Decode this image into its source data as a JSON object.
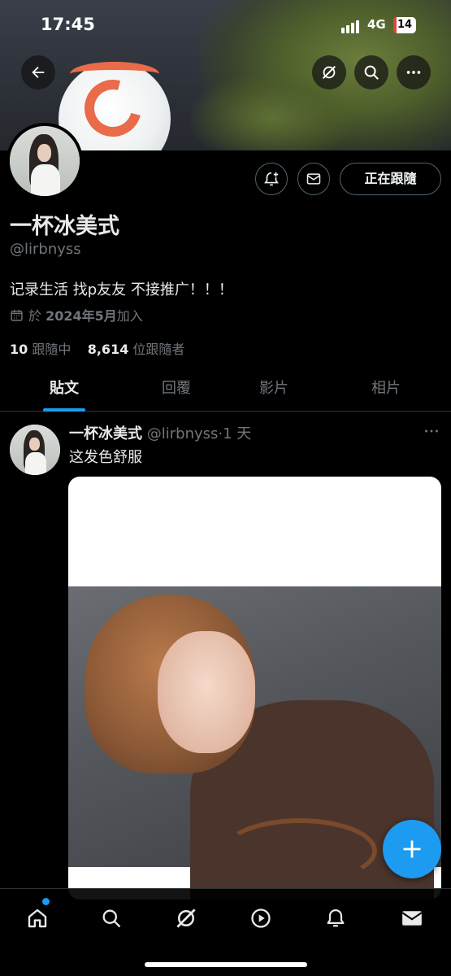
{
  "status_bar": {
    "time": "17:45",
    "network": "4G",
    "battery": "14"
  },
  "profile": {
    "display_name": "一杯冰美式",
    "handle": "@lirbnyss",
    "bio": "记录生活 找p友友 不接推广！！！",
    "joined_prefix": "於 ",
    "joined_date": "2024年5月",
    "joined_suffix": "加入",
    "following_count": "10",
    "following_label": "跟隨中",
    "followers_count": "8,614",
    "followers_label": "位跟隨者",
    "follow_button_label": "正在跟隨"
  },
  "tabs": [
    {
      "label": "貼文",
      "active": true
    },
    {
      "label": "回覆",
      "active": false
    },
    {
      "label": "影片",
      "active": false
    },
    {
      "label": "相片",
      "active": false
    }
  ],
  "post": {
    "author": "一杯冰美式",
    "handle": "@lirbnyss",
    "separator": "·",
    "time": "1 天",
    "text": "这发色舒服"
  },
  "icons": {
    "back": "arrow-left-icon",
    "grok": "grok-icon",
    "search": "search-icon",
    "more": "more-horizontal-icon",
    "notify": "bell-plus-icon",
    "message": "envelope-icon",
    "calendar": "calendar-icon",
    "compose": "plus-icon"
  },
  "bottom_nav": [
    "home-icon",
    "search-icon",
    "grok-icon",
    "video-play-icon",
    "bell-icon",
    "envelope-icon"
  ],
  "colors": {
    "accent": "#1d9bf0",
    "background": "#000000",
    "secondary_text": "#71767b"
  }
}
